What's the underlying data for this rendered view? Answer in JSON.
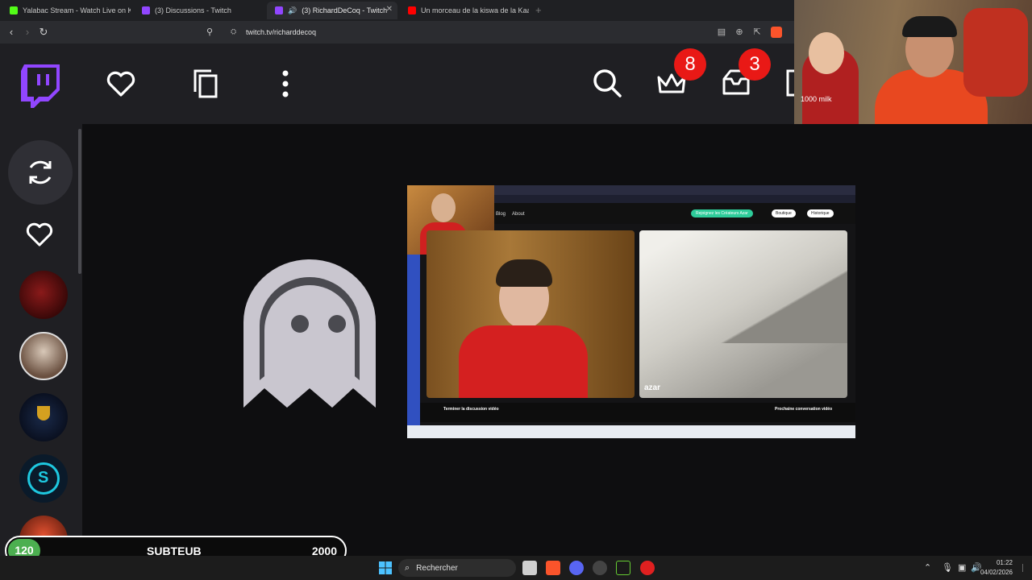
{
  "browser": {
    "tabs": [
      {
        "title": "Yalabac Stream - Watch Live on Kick",
        "active": false
      },
      {
        "title": "(3) Discussions - Twitch",
        "active": false
      },
      {
        "title": "(3) RichardDeCoq - Twitch",
        "active": true
      },
      {
        "title": "Un morceau de la kiswa de la Kaaba",
        "active": false
      }
    ],
    "new_tab_label": "+",
    "url": "twitch.tv/richarddecoq"
  },
  "twitch": {
    "notifications_count": "8",
    "inbox_count": "3"
  },
  "video": {
    "end_chat_label": "Terminer la discussion vidéo",
    "next_chat_label": "Prochaine conversation vidéo",
    "join_button": "Rejoignez les Créateurs Azar",
    "shop_button": "Boutique",
    "history_button": "Historique",
    "nav_blog": "Blog",
    "nav_about": "About",
    "brand": "azar"
  },
  "webcam": {
    "overlay_text": "1000 milk"
  },
  "subgoal": {
    "current": "120",
    "label": "SUBTEUB",
    "target": "2000"
  },
  "taskbar": {
    "search_placeholder": "Rechercher",
    "time": "01:22",
    "date": "04/02/2026"
  },
  "colors": {
    "twitch_purple": "#9146ff",
    "notif_red": "#e91916",
    "goal_green": "#4caf50"
  }
}
